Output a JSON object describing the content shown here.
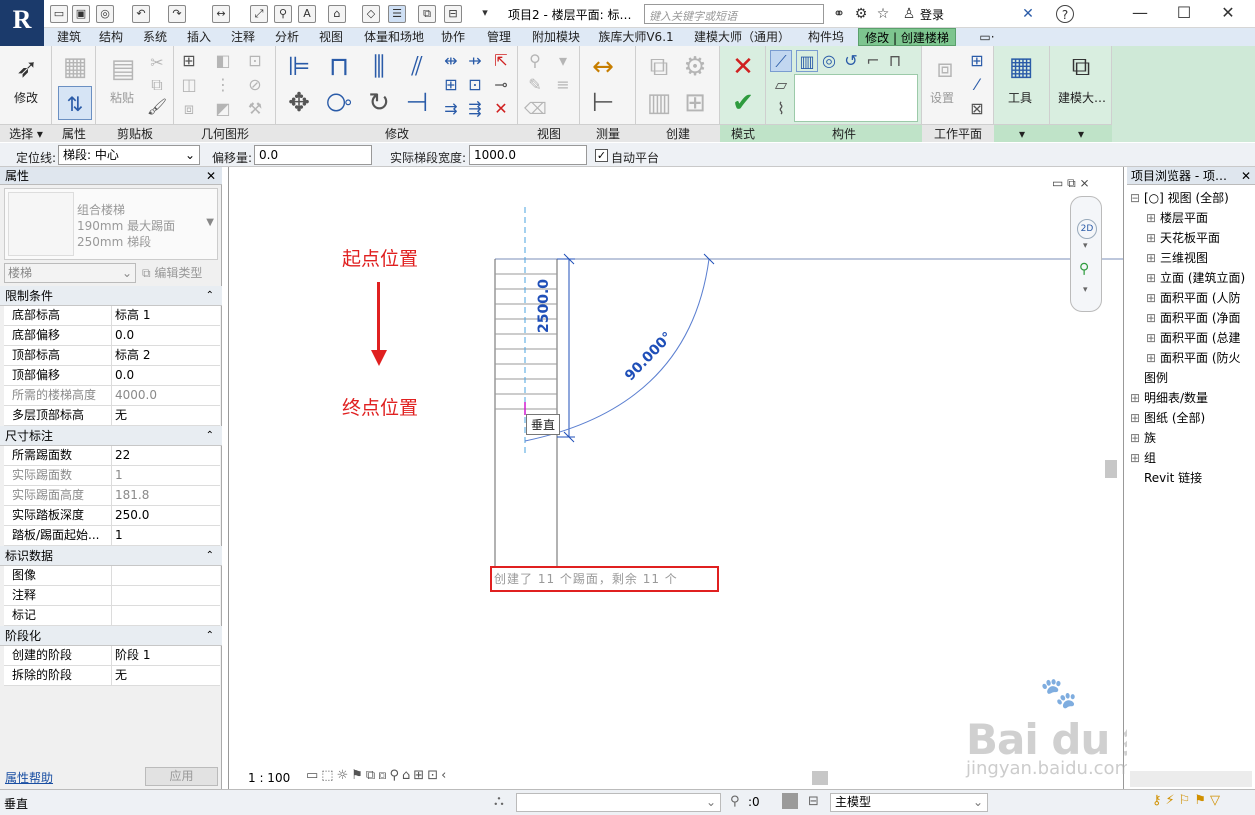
{
  "app": {
    "logo_letter": "R",
    "window_title": "项目2 - 楼层平面: 标…",
    "search_placeholder": "键入关键字或短语",
    "login": "登录",
    "help": "?",
    "minimize": "—",
    "maximize": "☐",
    "close": "✕"
  },
  "tabs": [
    {
      "label": "建筑"
    },
    {
      "label": "结构"
    },
    {
      "label": "系统"
    },
    {
      "label": "插入"
    },
    {
      "label": "注释"
    },
    {
      "label": "分析"
    },
    {
      "label": "视图"
    },
    {
      "label": "体量和场地"
    },
    {
      "label": "协作"
    },
    {
      "label": "管理"
    },
    {
      "label": "附加模块"
    },
    {
      "label": "族库大师V6.1"
    },
    {
      "label": "建模大师（通用）"
    },
    {
      "label": "构件坞"
    },
    {
      "label": "修改 | 创建楼梯"
    },
    {
      "label": "▭·"
    }
  ],
  "ribbon": {
    "modify_label": "修改",
    "paste_label": "粘贴",
    "settings_label": "设置",
    "tools_label": "工具",
    "modeling_label": "建模大…",
    "panels": {
      "select": "选择 ▾",
      "properties": "属性",
      "clipboard": "剪贴板",
      "geometry": "几何图形",
      "modify": "修改",
      "view": "视图",
      "measure": "测量",
      "create": "创建",
      "mode": "模式",
      "components": "构件",
      "workplane": "工作平面",
      "tools_drop": "▾",
      "modeling_drop": "▾"
    }
  },
  "options_bar": {
    "locline_label": "定位线:",
    "locline_value": "梯段: 中心",
    "offset_label": "偏移量:",
    "offset_value": "0.0",
    "width_label": "实际梯段宽度:",
    "width_value": "1000.0",
    "auto_platform_label": "自动平台",
    "auto_platform_checked": true
  },
  "properties": {
    "title": "属性",
    "type_family": "组合楼梯",
    "type_line2": "190mm 最大踢面",
    "type_line3": "250mm 梯段",
    "category": "楼梯",
    "edit_type": "编辑类型",
    "sections": [
      {
        "name": "限制条件",
        "rows": [
          {
            "k": "底部标高",
            "v": "标高 1",
            "dim": false
          },
          {
            "k": "底部偏移",
            "v": "0.0",
            "dim": false
          },
          {
            "k": "顶部标高",
            "v": "标高 2",
            "dim": false
          },
          {
            "k": "顶部偏移",
            "v": "0.0",
            "dim": false
          },
          {
            "k": "所需的楼梯高度",
            "v": "4000.0",
            "dim": true
          },
          {
            "k": "多层顶部标高",
            "v": "无",
            "dim": false
          }
        ]
      },
      {
        "name": "尺寸标注",
        "rows": [
          {
            "k": "所需踢面数",
            "v": "22",
            "dim": false
          },
          {
            "k": "实际踢面数",
            "v": "1",
            "dim": true
          },
          {
            "k": "实际踢面高度",
            "v": "181.8",
            "dim": true
          },
          {
            "k": "实际踏板深度",
            "v": "250.0",
            "dim": false
          },
          {
            "k": "踏板/踢面起始...",
            "v": "1",
            "dim": false
          }
        ]
      },
      {
        "name": "标识数据",
        "rows": [
          {
            "k": "图像",
            "v": "",
            "dim": false
          },
          {
            "k": "注释",
            "v": "",
            "dim": false
          },
          {
            "k": "标记",
            "v": "",
            "dim": false
          }
        ]
      },
      {
        "name": "阶段化",
        "rows": [
          {
            "k": "创建的阶段",
            "v": "阶段 1",
            "dim": false
          },
          {
            "k": "拆除的阶段",
            "v": "无",
            "dim": false
          }
        ]
      }
    ],
    "help_link": "属性帮助",
    "apply": "应用"
  },
  "canvas": {
    "start_label": "起点位置",
    "end_label": "终点位置",
    "dim_text": "2500.0",
    "angle_text": "90.000°",
    "tooltip": "垂直",
    "status_msg": "创建了 11 个踢面，剩余 11 个",
    "scale": "1 : 100",
    "watermark_main": "Bai du 经验",
    "watermark_url": "jingyan.baidu.com",
    "colors": {
      "annotation": "#e02020",
      "dimension": "#1f4fb8",
      "highlight_box": "#e02020"
    }
  },
  "browser": {
    "title": "项目浏览器 - 项…",
    "items": [
      {
        "label": "[○] 视图 (全部)",
        "level": 0,
        "exp": "⊟"
      },
      {
        "label": "楼层平面",
        "level": 1,
        "exp": "⊞"
      },
      {
        "label": "天花板平面",
        "level": 1,
        "exp": "⊞"
      },
      {
        "label": "三维视图",
        "level": 1,
        "exp": "⊞"
      },
      {
        "label": "立面 (建筑立面)",
        "level": 1,
        "exp": "⊞"
      },
      {
        "label": "面积平面 (人防",
        "level": 1,
        "exp": "⊞"
      },
      {
        "label": "面积平面 (净面",
        "level": 1,
        "exp": "⊞"
      },
      {
        "label": "面积平面 (总建",
        "level": 1,
        "exp": "⊞"
      },
      {
        "label": "面积平面 (防火",
        "level": 1,
        "exp": "⊞"
      },
      {
        "label": "图例",
        "level": 0,
        "exp": ""
      },
      {
        "label": "明细表/数量",
        "level": 0,
        "exp": "⊞"
      },
      {
        "label": "图纸 (全部)",
        "level": 0,
        "exp": "⊞"
      },
      {
        "label": "族",
        "level": 0,
        "exp": "⊞"
      },
      {
        "label": "组",
        "level": 0,
        "exp": "⊞"
      },
      {
        "label": "Revit 链接",
        "level": 0,
        "exp": ""
      }
    ]
  },
  "statusbar": {
    "text": "垂直",
    "coord": ":0",
    "model": "主模型"
  }
}
